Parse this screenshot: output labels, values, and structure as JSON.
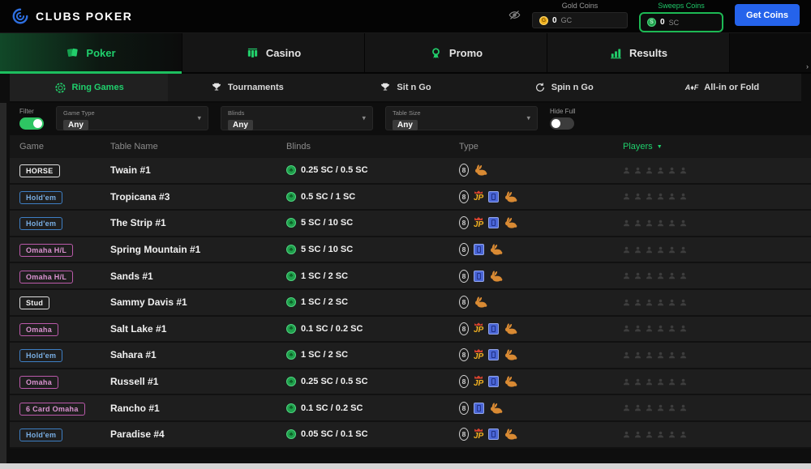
{
  "header": {
    "brand": "CLUBS POKER",
    "gold": {
      "label": "Gold Coins",
      "amount": "0",
      "currency": "GC"
    },
    "sweeps": {
      "label": "Sweeps Coins",
      "amount": "0",
      "currency": "SC"
    },
    "get_coins": "Get Coins"
  },
  "main_nav": [
    {
      "label": "Poker",
      "active": true
    },
    {
      "label": "Casino",
      "active": false
    },
    {
      "label": "Promo",
      "active": false
    },
    {
      "label": "Results",
      "active": false
    }
  ],
  "sub_nav": [
    {
      "label": "Ring Games",
      "active": true
    },
    {
      "label": "Tournaments",
      "active": false
    },
    {
      "label": "Sit n Go",
      "active": false
    },
    {
      "label": "Spin n Go",
      "active": false
    },
    {
      "label": "All-in or Fold",
      "active": false
    }
  ],
  "filters": {
    "filter": {
      "label": "Filter",
      "on": true
    },
    "game_type": {
      "label": "Game Type",
      "value": "Any"
    },
    "blinds": {
      "label": "Blinds",
      "value": "Any"
    },
    "table_size": {
      "label": "Table Size",
      "value": "Any"
    },
    "hide_full": {
      "label": "Hide Full",
      "on": false
    }
  },
  "icons": {
    "chevron_down": "▾",
    "sort_desc": "▼",
    "aof_glyph": "A♦F",
    "coin_glyph": "♣"
  },
  "table": {
    "columns": {
      "game": "Game",
      "name": "Table Name",
      "blinds": "Blinds",
      "type": "Type",
      "players": "Players"
    },
    "sort": {
      "column": "Players",
      "direction": "desc"
    },
    "rows": [
      {
        "game": "HORSE",
        "style": "white",
        "name": "Twain #1",
        "blinds": "0.25 SC / 0.5 SC",
        "type_icons": [
          "oval8",
          "rabbit"
        ],
        "seats": 6,
        "players": 0
      },
      {
        "game": "Hold'em",
        "style": "blue",
        "name": "Tropicana #3",
        "blinds": "0.5 SC / 1 SC",
        "type_icons": [
          "oval8",
          "jp",
          "deck",
          "rabbit"
        ],
        "seats": 6,
        "players": 0
      },
      {
        "game": "Hold'em",
        "style": "blue",
        "name": "The Strip #1",
        "blinds": "5 SC / 10 SC",
        "type_icons": [
          "oval8",
          "jp",
          "deck",
          "rabbit"
        ],
        "seats": 6,
        "players": 0
      },
      {
        "game": "Omaha H/L",
        "style": "pink",
        "name": "Spring Mountain #1",
        "blinds": "5 SC / 10 SC",
        "type_icons": [
          "oval8",
          "deck",
          "rabbit"
        ],
        "seats": 6,
        "players": 0
      },
      {
        "game": "Omaha H/L",
        "style": "pink",
        "name": "Sands #1",
        "blinds": "1 SC / 2 SC",
        "type_icons": [
          "oval8",
          "deck",
          "rabbit"
        ],
        "seats": 6,
        "players": 0
      },
      {
        "game": "Stud",
        "style": "white",
        "name": "Sammy Davis #1",
        "blinds": "1 SC / 2 SC",
        "type_icons": [
          "oval8",
          "rabbit"
        ],
        "seats": 6,
        "players": 0
      },
      {
        "game": "Omaha",
        "style": "pink",
        "name": "Salt Lake #1",
        "blinds": "0.1 SC / 0.2 SC",
        "type_icons": [
          "oval8",
          "jp",
          "deck",
          "rabbit"
        ],
        "seats": 6,
        "players": 0
      },
      {
        "game": "Hold'em",
        "style": "blue",
        "name": "Sahara #1",
        "blinds": "1 SC / 2 SC",
        "type_icons": [
          "oval8",
          "jp",
          "deck",
          "rabbit"
        ],
        "seats": 6,
        "players": 0
      },
      {
        "game": "Omaha",
        "style": "pink",
        "name": "Russell #1",
        "blinds": "0.25 SC / 0.5 SC",
        "type_icons": [
          "oval8",
          "jp",
          "deck",
          "rabbit"
        ],
        "seats": 6,
        "players": 0
      },
      {
        "game": "6 Card Omaha",
        "style": "pink",
        "name": "Rancho #1",
        "blinds": "0.1 SC / 0.2 SC",
        "type_icons": [
          "oval8",
          "deck",
          "rabbit"
        ],
        "seats": 6,
        "players": 0
      },
      {
        "game": "Hold'em",
        "style": "blue",
        "name": "Paradise #4",
        "blinds": "0.05 SC / 0.1 SC",
        "type_icons": [
          "oval8",
          "jp",
          "deck",
          "rabbit"
        ],
        "seats": 6,
        "players": 0
      }
    ]
  },
  "colors": {
    "accent_green": "#1dbf5f",
    "button_blue": "#2563eb",
    "badge_blue": "#79aee3",
    "badge_pink": "#dc94d2",
    "jackpot_gold": "#f3b222",
    "rabbit_orange": "#d98a33"
  }
}
